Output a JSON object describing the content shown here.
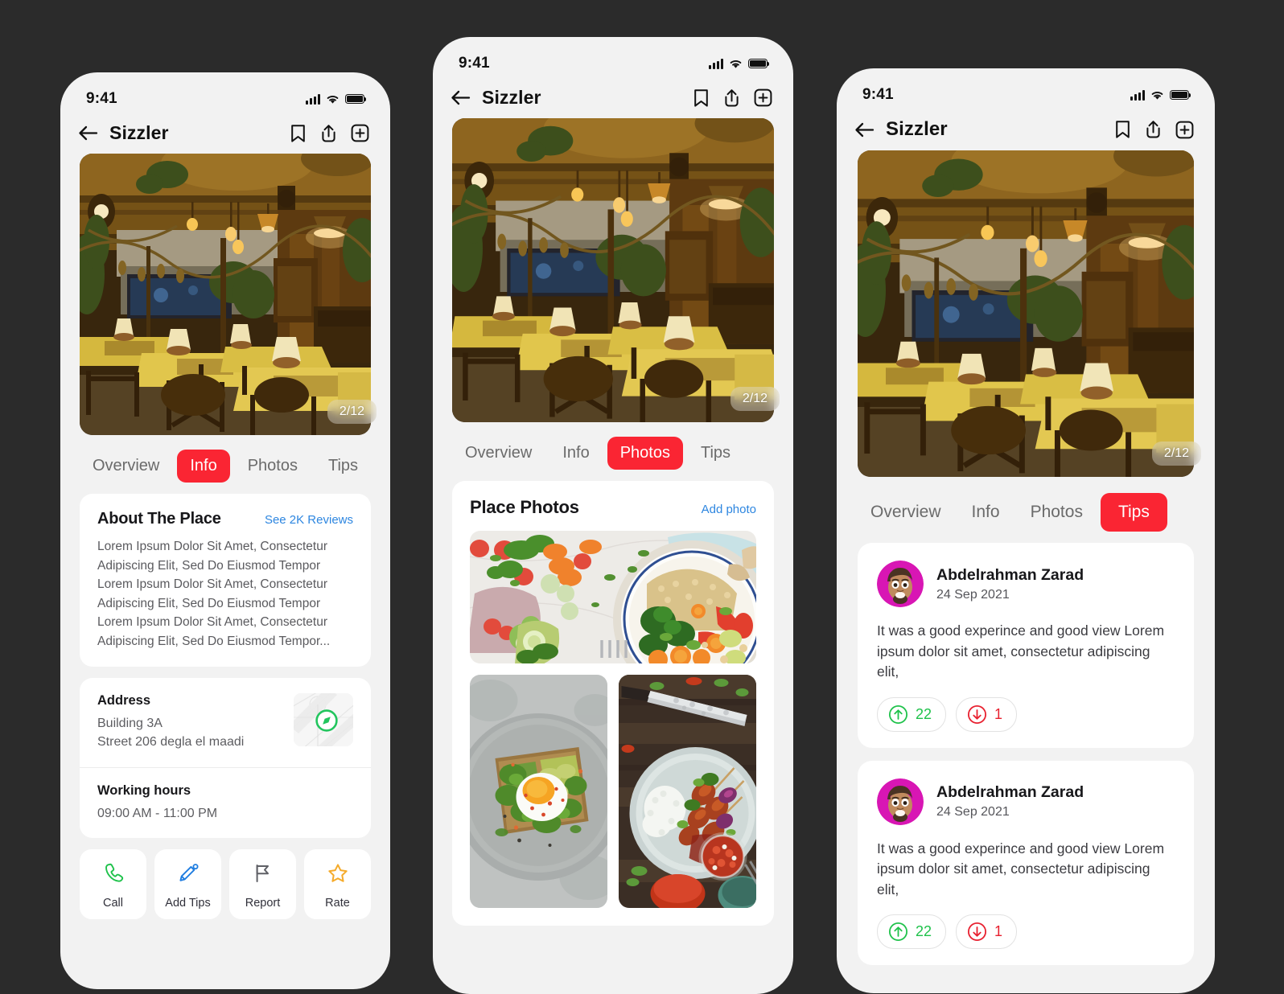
{
  "canvas": {
    "background": "#2b2b2b"
  },
  "theme": {
    "accent": "#fa2533",
    "link": "#2d86e0",
    "screen_bg": "#f2f2f2",
    "card_bg": "#ffffff",
    "upvote": "#1fc24b",
    "downvote": "#e8202f",
    "call_icon": "#1fc24b",
    "tips_icon": "#1f7de0",
    "report_icon": "#5f6066",
    "rate_icon": "#f5ab2b",
    "compass": "#22c55e"
  },
  "status_bar": {
    "time": "9:41",
    "icons": [
      "signal-icon",
      "wifi-icon",
      "battery-icon"
    ]
  },
  "nav": {
    "back_icon": "arrow-left-icon",
    "title": "Sizzler",
    "actions": [
      {
        "icon": "bookmark-icon",
        "name": "bookmark-button"
      },
      {
        "icon": "share-icon",
        "name": "share-button"
      },
      {
        "icon": "plus-square-icon",
        "name": "add-button"
      }
    ]
  },
  "hero": {
    "alt": "restaurant-interior-photo",
    "badge": "2/12"
  },
  "tabs": {
    "labels": [
      "Overview",
      "Info",
      "Photos",
      "Tips"
    ],
    "screen1_active": "Info",
    "screen2_active": "Photos",
    "screen3_active": "Tips"
  },
  "screen_info": {
    "about": {
      "title": "About The Place",
      "link": "See 2K Reviews",
      "body": "Lorem Ipsum Dolor Sit Amet, Consectetur Adipiscing Elit, Sed Do Eiusmod Tempor Lorem Ipsum Dolor Sit Amet, Consectetur Adipiscing Elit, Sed Do Eiusmod Tempor Lorem Ipsum Dolor Sit Amet, Consectetur Adipiscing Elit, Sed Do Eiusmod Tempor..."
    },
    "address": {
      "label": "Address",
      "line1": "Building 3A",
      "line2": "Street 206 degla el maadi",
      "map_icon": "compass-icon"
    },
    "working_hours": {
      "label": "Working hours",
      "value": "09:00 AM - 11:00 PM"
    },
    "actions": [
      {
        "label": "Call",
        "icon": "phone-icon"
      },
      {
        "label": "Add Tips",
        "icon": "pencil-icon"
      },
      {
        "label": "Report",
        "icon": "flag-icon"
      },
      {
        "label": "Rate",
        "icon": "star-icon"
      }
    ]
  },
  "screen_photos": {
    "title": "Place Photos",
    "link": "Add photo",
    "items": [
      {
        "alt": "vegetable-bowl-photo"
      },
      {
        "alt": "avocado-toast-photo"
      },
      {
        "alt": "skewers-rice-photo"
      }
    ]
  },
  "screen_tips": {
    "reviews": [
      {
        "name": "Abdelrahman Zarad",
        "date": "24 Sep 2021",
        "text": "It was a good experince and good view Lorem ipsum dolor sit amet, consectetur adipiscing elit,",
        "upvotes": "22",
        "downvotes": "1"
      },
      {
        "name": "Abdelrahman Zarad",
        "date": "24 Sep 2021",
        "text": "It was a good experince and good view Lorem ipsum dolor sit amet, consectetur adipiscing elit,",
        "upvotes": "22",
        "downvotes": "1"
      }
    ]
  }
}
